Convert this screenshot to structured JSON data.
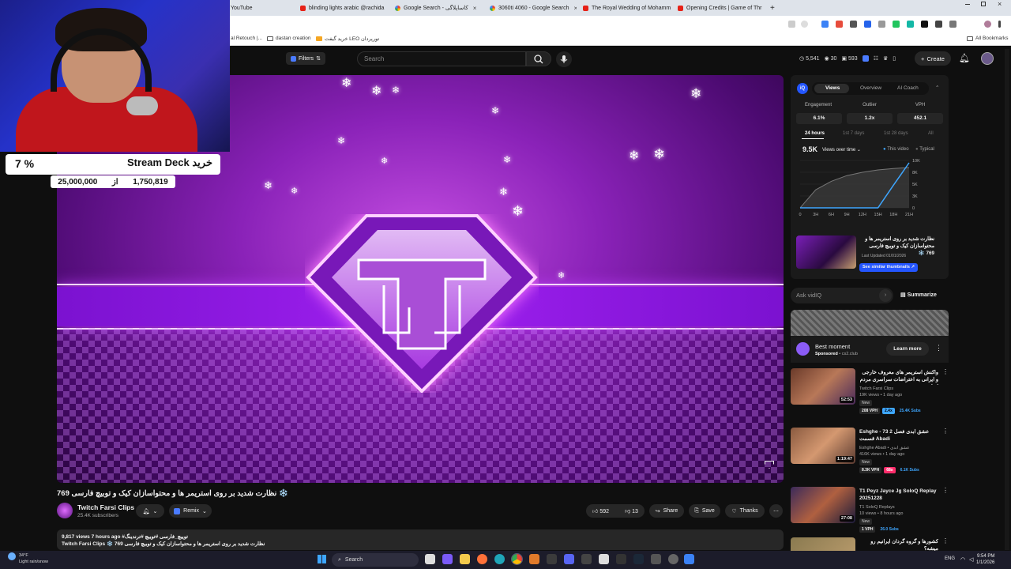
{
  "browser": {
    "tabs": [
      {
        "title": "YouTube",
        "type": "yt"
      },
      {
        "title": "blinding lights arabic @rachida",
        "type": "yt"
      },
      {
        "title": "Google Search - کاساپلاگی",
        "type": "g"
      },
      {
        "title": "3060ti 4060 - Google Search",
        "type": "g"
      },
      {
        "title": "The Royal Wedding of Mohamm",
        "type": "yt"
      },
      {
        "title": "Opening Credits | Game of Thr",
        "type": "yt"
      }
    ],
    "new_tab": "+",
    "bookmarks": [
      "al Retouch |...",
      "dastan creation",
      "خرید گیفت LEO تورپردان"
    ],
    "all_bookmarks": "All Bookmarks"
  },
  "youtube": {
    "filters_label": "Filters",
    "search_placeholder": "Search",
    "stats": [
      "5,541",
      "30",
      "593"
    ],
    "create_label": "Create"
  },
  "overlay": {
    "percent": "7 %",
    "title": "Stream Deck خرید",
    "current": "1,750,819",
    "of": "از",
    "goal": "25,000,000"
  },
  "video": {
    "title": "نظارت شدید بر روی استریمر ها و محتواسازان کیک و توبیچ فارسی 769 ❄️",
    "channel": "Twitch Farsi Clips",
    "subscribers": "25.4K subscribers",
    "remix": "Remix",
    "likes": "592",
    "dislikes": "13",
    "share": "Share",
    "save": "Save",
    "thanks": "Thanks",
    "desc_line1": "9,817 views  7 hours ago  #توییچ_فارسی #توییچ #ترندینگ",
    "desc_line2": "Twitch Farsi Clips ❄️ نظارت شدید بر روی استریمر ها و محتواسازان کیک و توبیچ فارسی 769"
  },
  "vidiq": {
    "tabs": [
      "Views",
      "Overview",
      "AI Coach"
    ],
    "metrics": [
      {
        "label": "Engagement",
        "value": "6.1%"
      },
      {
        "label": "Outlier",
        "value": "1.2x"
      },
      {
        "label": "VPH",
        "value": "452.1"
      }
    ],
    "ranges": [
      "24 hours",
      "1st 7 days",
      "1st 28 days",
      "All"
    ],
    "views_total": "9.5K",
    "views_mode": "Views over time",
    "legend_this": "This video",
    "legend_typical": "Typical",
    "chart_data": {
      "type": "line",
      "x": [
        "0",
        "3H",
        "6H",
        "9H",
        "12H",
        "15H",
        "18H",
        "21H"
      ],
      "ylim": [
        0,
        10000
      ],
      "y_ticks": [
        "10K",
        "8K",
        "5K",
        "3K",
        "0"
      ],
      "series": [
        {
          "name": "This video",
          "values": [
            0,
            0,
            0,
            0,
            0,
            0,
            4800,
            9500
          ]
        },
        {
          "name": "Typical",
          "values": [
            0,
            3800,
            5600,
            6800,
            7500,
            8000,
            8300,
            8500
          ]
        }
      ]
    },
    "thumb_title": "نظارت شدید بر روی استریمر ها و محتواسازان کیک و توبیچ فارسی 769 ❄️",
    "last_updated": "Last Updated 01/01/2026",
    "similar_btn": "See similar thumbnails",
    "ask_placeholder": "Ask vidIQ",
    "summarize": "Summarize"
  },
  "ad": {
    "title": "Best moment",
    "sponsored": "Sponsored",
    "domain": "cs2.club",
    "learn_more": "Learn more"
  },
  "recommendations": [
    {
      "title": "واکنش استریمر های معروف خارجی و ایرانی به اعتراضات سراسری مردم ایران",
      "channel": "Twitch Farsi Clips",
      "views": "19K views • 1 day ago",
      "duration": "52:53",
      "badge": "New",
      "tags": [
        "208 VPH",
        "2.4x",
        "25.4K Subs"
      ],
      "thumb": "#6a3a2a"
    },
    {
      "title": "Eshghe - 73 عشق ابدی فصل 2 قسمت Abadi",
      "channel": "Eshghe Abadi • عشق ابدی",
      "views": "416K views • 1 day ago",
      "duration": "1:19:47",
      "badge": "New",
      "tags": [
        "8.3K VPH",
        "68x",
        "6.1K Subs"
      ],
      "thumb": "#8a5a40"
    },
    {
      "title": "T1 Peyz Jayce Jg SoloQ Replay 20251228",
      "channel": "T1 SoloQ Replays",
      "views": "10 views • 8 hours ago",
      "duration": "27:08",
      "badge": "New",
      "tags": [
        "1 VPH",
        "26.0 Subs"
      ],
      "thumb": "#3b2a5a"
    },
    {
      "title": "کشورها و گروه گردان ایرانیم رو میشه؟",
      "channel": "",
      "views": "",
      "duration": "",
      "badge": "",
      "tags": [],
      "thumb": "#8a7a50"
    }
  ],
  "taskbar": {
    "weather_temp": "34°F",
    "weather_desc": "Light rain/snow",
    "search": "Search",
    "lang": "ENG",
    "time": "9:54 PM",
    "date": "1/1/2026"
  }
}
